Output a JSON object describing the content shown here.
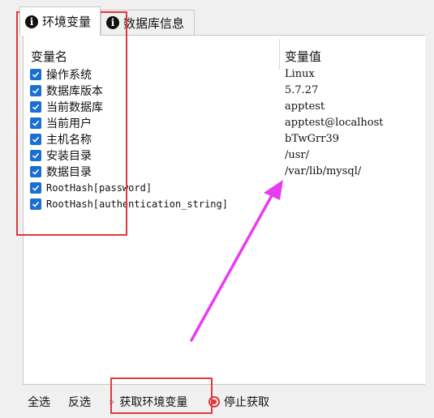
{
  "tabs": [
    {
      "label": "环境变量",
      "icon": "info-icon",
      "active": true
    },
    {
      "label": "数据库信息",
      "icon": "info-icon",
      "active": false
    }
  ],
  "table": {
    "headers": {
      "name": "变量名",
      "value": "变量值"
    },
    "rows": [
      {
        "name": "操作系统",
        "value": "Linux"
      },
      {
        "name": "数据库版本",
        "value": "5.7.27"
      },
      {
        "name": "当前数据库",
        "value": "apptest"
      },
      {
        "name": "当前用户",
        "value": "apptest@localhost"
      },
      {
        "name": "主机名称",
        "value": "bTwGrr39"
      },
      {
        "name": "安装目录",
        "value": "/usr/"
      },
      {
        "name": "数据目录",
        "value": "/var/lib/mysql/"
      },
      {
        "name": "RootHash[password]",
        "value": ""
      },
      {
        "name": "RootHash[authentication_string]",
        "value": ""
      }
    ]
  },
  "bottom": {
    "select_all": "全选",
    "invert": "反选",
    "fetch_icon": "double-chevron-right-icon",
    "fetch": "获取环境变量",
    "stop_icon": "record-stop-icon",
    "stop": "停止获取"
  },
  "colors": {
    "checkbox": "#1a6fd1",
    "highlight_box": "#e0393e",
    "annotation_arrow": "#e83cf0"
  }
}
